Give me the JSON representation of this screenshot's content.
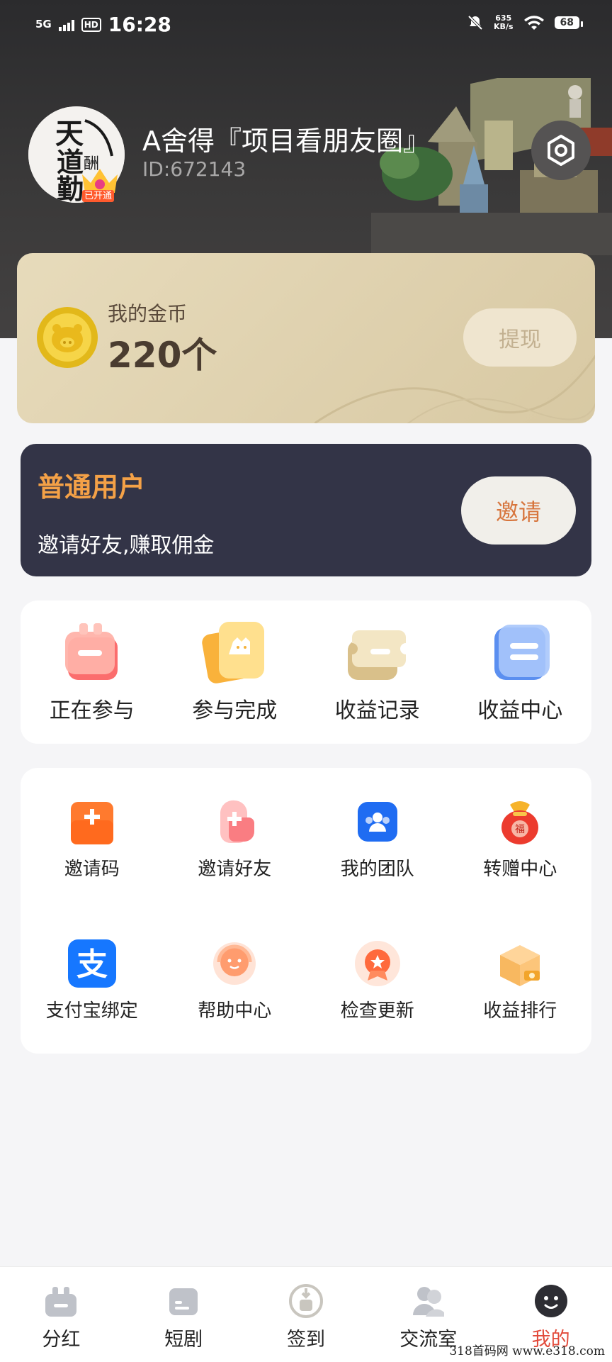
{
  "status_bar": {
    "network": "5G",
    "hd": "HD",
    "time": "16:28",
    "net_speed_value": "635",
    "net_speed_unit": "KB/s",
    "battery": "68"
  },
  "profile": {
    "name": "A舍得『项目看朋友圈』",
    "id_text": "ID:672143",
    "vip_badge": "已开通",
    "avatar_calligraphy": "天道酬勤"
  },
  "coins": {
    "label": "我的金币",
    "value": "220个",
    "withdraw_label": "提现"
  },
  "membership": {
    "level": "普通用户",
    "description": "邀请好友,赚取佣金",
    "invite_label": "邀请"
  },
  "quick_actions": [
    {
      "label": "正在参与",
      "icon": "gift-box-icon"
    },
    {
      "label": "参与完成",
      "icon": "ticket-complete-icon"
    },
    {
      "label": "收益记录",
      "icon": "record-ticket-icon"
    },
    {
      "label": "收益中心",
      "icon": "income-card-icon"
    }
  ],
  "services": [
    {
      "label": "邀请码",
      "icon": "invite-code-icon"
    },
    {
      "label": "邀请好友",
      "icon": "invite-friends-icon"
    },
    {
      "label": "我的团队",
      "icon": "team-icon"
    },
    {
      "label": "转赠中心",
      "icon": "lucky-bag-icon"
    },
    {
      "label": "支付宝绑定",
      "icon": "alipay-icon"
    },
    {
      "label": "帮助中心",
      "icon": "headset-icon"
    },
    {
      "label": "检查更新",
      "icon": "update-badge-icon"
    },
    {
      "label": "收益排行",
      "icon": "ranking-box-icon"
    }
  ],
  "tabbar": [
    {
      "label": "分红",
      "icon": "gift-tab-icon",
      "active": false
    },
    {
      "label": "短剧",
      "icon": "drama-tab-icon",
      "active": false
    },
    {
      "label": "签到",
      "icon": "checkin-tab-icon",
      "active": false
    },
    {
      "label": "交流室",
      "icon": "chat-room-tab-icon",
      "active": false
    },
    {
      "label": "我的",
      "icon": "me-tab-icon",
      "active": true
    }
  ],
  "watermark": "318首码网 www.e318.com",
  "colors": {
    "header_bg": "#2b2b2d",
    "coin_card_bg": "#e2d5b4",
    "member_card_bg": "#333447",
    "member_level": "#f4a147",
    "invite_text": "#d7753d",
    "tab_active": "#e24a3a"
  }
}
